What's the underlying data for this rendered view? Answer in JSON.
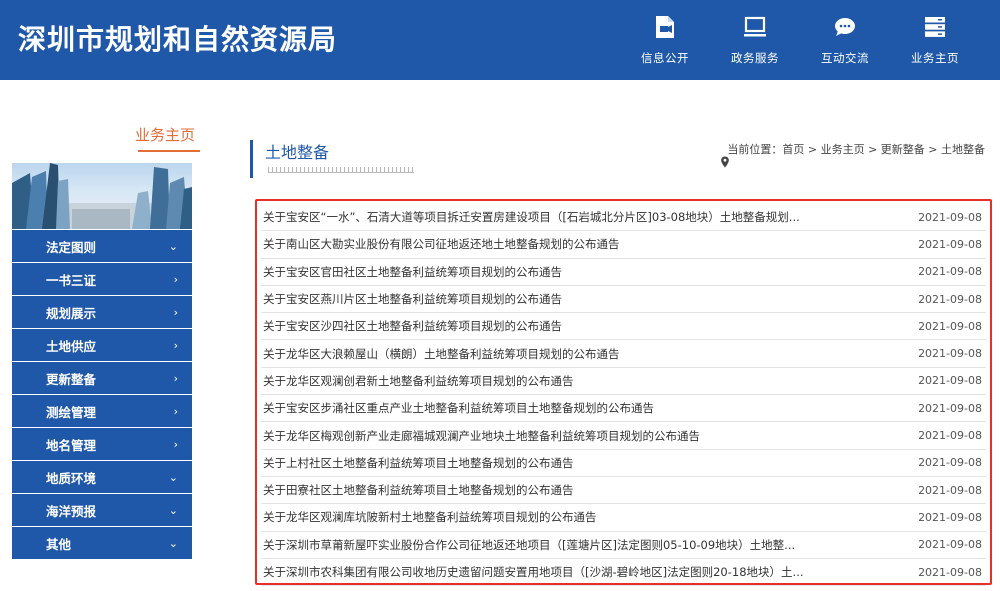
{
  "header": {
    "site_title": "深圳市规划和自然资源局",
    "nav": [
      {
        "label": "信息公开",
        "icon": "document-icon"
      },
      {
        "label": "政务服务",
        "icon": "monitor-icon"
      },
      {
        "label": "互动交流",
        "icon": "chat-icon"
      },
      {
        "label": "业务主页",
        "icon": "server-icon"
      }
    ]
  },
  "sidebar": {
    "title": "业务主页",
    "items": [
      {
        "label": "法定图则",
        "arrow": "⌄"
      },
      {
        "label": "一书三证",
        "arrow": "›"
      },
      {
        "label": "规划展示",
        "arrow": "›"
      },
      {
        "label": "土地供应",
        "arrow": "›"
      },
      {
        "label": "更新整备",
        "arrow": "›"
      },
      {
        "label": "测绘管理",
        "arrow": "›"
      },
      {
        "label": "地名管理",
        "arrow": "›"
      },
      {
        "label": "地质环境",
        "arrow": "⌄"
      },
      {
        "label": "海洋预报",
        "arrow": "⌄"
      },
      {
        "label": "其他",
        "arrow": "⌄"
      }
    ]
  },
  "main": {
    "title": "土地整备",
    "breadcrumb": {
      "prefix": "当前位置：",
      "path": "首页 > 业务主页 > 更新整备 > 土地整备"
    },
    "rows": [
      {
        "title": "关于宝安区“一水”、石清大道等项目拆迁安置房建设项目（[石岩城北分片区]03-08地块）土地整备规划...",
        "date": "2021-09-08"
      },
      {
        "title": "关于南山区大勘实业股份有限公司征地返还地土地整备规划的公布通告",
        "date": "2021-09-08"
      },
      {
        "title": "关于宝安区官田社区土地整备利益统筹项目规划的公布通告",
        "date": "2021-09-08"
      },
      {
        "title": "关于宝安区燕川片区土地整备利益统筹项目规划的公布通告",
        "date": "2021-09-08"
      },
      {
        "title": "关于宝安区沙四社区土地整备利益统筹项目规划的公布通告",
        "date": "2021-09-08"
      },
      {
        "title": "关于龙华区大浪赖屋山（横朗）土地整备利益统筹项目规划的公布通告",
        "date": "2021-09-08"
      },
      {
        "title": "关于龙华区观澜创君新土地整备利益统筹项目规划的公布通告",
        "date": "2021-09-08"
      },
      {
        "title": "关于宝安区步涌社区重点产业土地整备利益统筹项目土地整备规划的公布通告",
        "date": "2021-09-08"
      },
      {
        "title": "关于龙华区梅观创新产业走廊福城观澜产业地块土地整备利益统筹项目规划的公布通告",
        "date": "2021-09-08"
      },
      {
        "title": "关于上村社区土地整备利益统筹项目土地整备规划的公布通告",
        "date": "2021-09-08"
      },
      {
        "title": "关于田寮社区土地整备利益统筹项目土地整备规划的公布通告",
        "date": "2021-09-08"
      },
      {
        "title": "关于龙华区观澜库坑陂新村土地整备利益统筹项目规划的公布通告",
        "date": "2021-09-08"
      },
      {
        "title": "关于深圳市草莆新屋吓实业股份合作公司征地返还地项目（[莲塘片区]法定图则05-10-09地块）土地整...",
        "date": "2021-09-08"
      },
      {
        "title": "关于深圳市农科集团有限公司收地历史遗留问题安置用地项目（[沙湖-碧岭地区]法定图则20-18地块）土...",
        "date": "2021-09-08"
      }
    ]
  },
  "colors": {
    "brand_blue": "#1f58a8",
    "accent_orange": "#e36d36",
    "highlight_red": "#e8302a"
  }
}
